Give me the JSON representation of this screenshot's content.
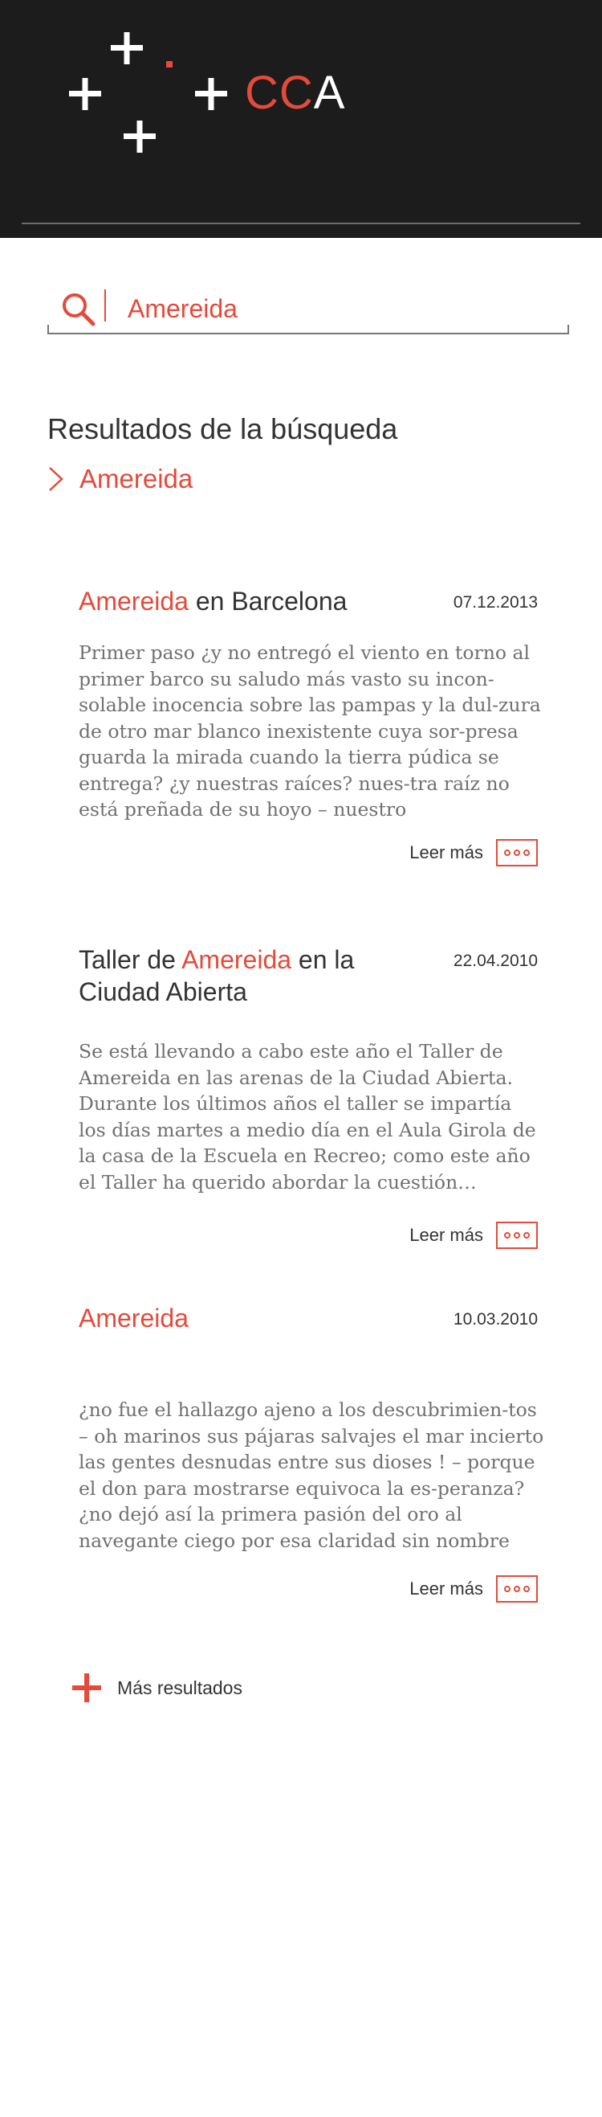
{
  "brand": {
    "logo_cc": "CC",
    "logo_a": "A",
    "colors": {
      "accent": "#e54a3a",
      "header_bg": "#1c1c1c",
      "text": "#333333",
      "excerpt": "#707070"
    }
  },
  "search": {
    "value": "Amereida",
    "icon": "search-icon"
  },
  "results": {
    "title": "Resultados de la búsqueda",
    "query": "Amereida",
    "items": [
      {
        "title_parts": [
          "Amereida",
          " en Barcelona"
        ],
        "date": "07.12.2013",
        "excerpt": "Primer paso ¿y no entregó el viento en torno al primer barco su saludo más vasto su incon-solable inocencia sobre las pampas y la dul-zura de otro mar blanco inexistente cuya sor-presa guarda la mirada cuando la tierra púdica se entrega? ¿y nuestras raíces? nues-tra raíz no está preñada de su hoyo – nuestro",
        "read_more": "Leer más"
      },
      {
        "title_parts": [
          "Taller de ",
          "Amereida",
          " en la Ciudad Abierta"
        ],
        "date": "22.04.2010",
        "excerpt": "Se está llevando a cabo este año el Taller de Amereida en las arenas de la Ciudad Abierta. Durante los últimos años el taller se impartía los días martes a medio día en el Aula Girola de la casa de la Escuela en Recreo; como este año el Taller ha querido abordar la cuestión…",
        "read_more": "Leer más"
      },
      {
        "title_parts": [
          "Amereida"
        ],
        "date": "10.03.2010",
        "excerpt": "¿no fue el hallazgo ajeno a los descubrimien-tos – oh marinos sus pájaras salvajes el mar incierto las gentes desnudas entre sus dioses ! – porque el don para mostrarse equivoca la es-peranza? ¿no dejó así la primera pasión del oro al navegante ciego por esa claridad sin nombre con que la tarde premia y…",
        "read_more": "Leer más"
      }
    ],
    "more_label": "Más resultados"
  }
}
